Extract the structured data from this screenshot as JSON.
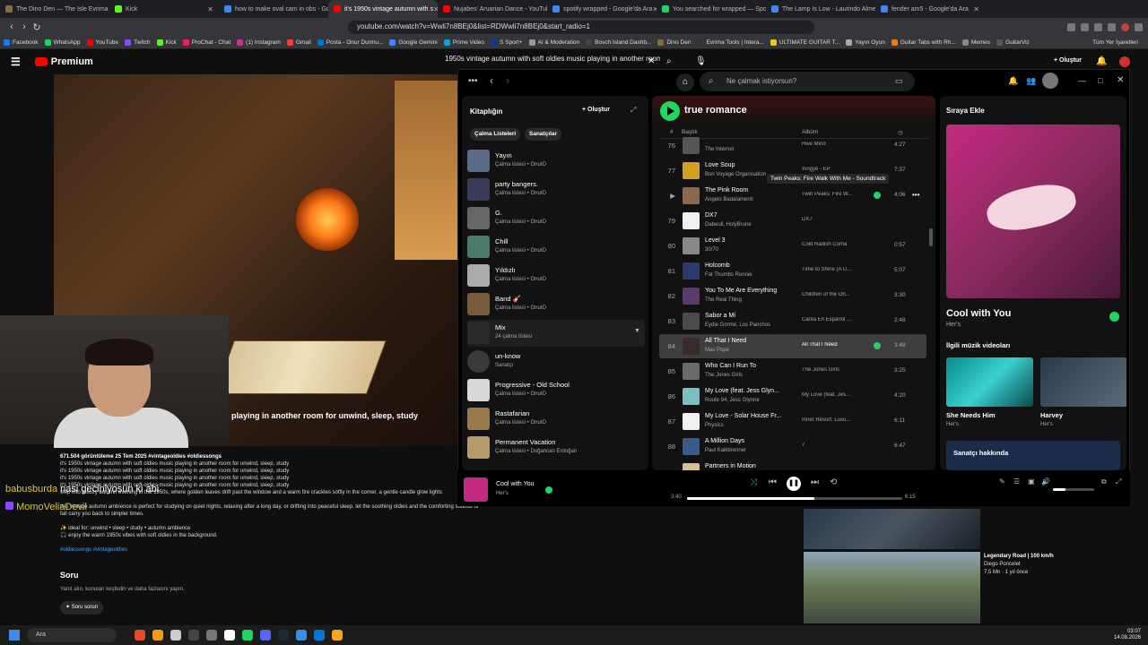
{
  "browser": {
    "tabs": [
      {
        "title": "The Dino Den — The Isle Evrima Co",
        "color": "#8a6a3a"
      },
      {
        "title": "Kick",
        "color": "#53fc18"
      },
      {
        "title": "how to make oval cam in obs - Goog",
        "color": "#4285f4"
      },
      {
        "title": "it's 1950s vintage autumn with s",
        "color": "#ff0000",
        "active": true
      },
      {
        "title": "Nujabes' Aruarian Dance - YouTube",
        "color": "#ff0000"
      },
      {
        "title": "spotify wrapped - Google'da Ara",
        "color": "#4285f4"
      },
      {
        "title": "You searched for wrapped — Spotify",
        "color": "#1ed760"
      },
      {
        "title": "The Lamp Is Low - Laurindo Almeida",
        "color": "#4285f4"
      },
      {
        "title": "fender am5 - Google'da Ara",
        "color": "#4285f4"
      }
    ],
    "url": "youtube.com/watch?v=Wwli7n8BEj0&list=RDWwli7n8BEj0&start_radio=1",
    "bookmarks": [
      "Facebook",
      "WhatsApp",
      "YouTube",
      "Twitch",
      "Kick",
      "ProChat - Chat",
      "(1) Instagram",
      "Gmail",
      "Posta - Onur Durmu...",
      "Google Gemini",
      "Prime Video",
      "S Sport+",
      "AI & Moderation",
      "Bosch Island Dashb...",
      "Dino Den",
      "Evrima Tools | Intera...",
      "ULTIMATE GUITAR T...",
      "Yayın Oyun",
      "Guitar Tabs with Rh...",
      "Memes",
      "GuitarViz"
    ],
    "bookmarks_all": "Tüm Yer İşaretleri"
  },
  "youtube": {
    "logo": "Premium",
    "search_value": "1950s vintage autumn with soft oldies music playing in another room",
    "create_label": "+ Oluştur",
    "video_title_visible": "playing in another room for unwind, sleep, study",
    "views": "671.504 görüntüleme  25 Tem 2025  #vintageoldies #oldiessongs",
    "desc_lines": [
      "it's 1950s vintage autumn with soft oldies music playing in another room for unwind, sleep, study",
      "it's 1950s vintage autumn with soft oldies music playing in another room for unwind, sleep, study",
      "it's 1950s vintage autumn with soft oldies music playing in another room for unwind, sleep, study",
      "it's 1950s vintage autumn with soft oldies music playing in another room for unwind, sleep, study",
      "step into a cozy autumn evening in the 1950s, where golden leaves drift past the window and a warm fire crackles softly in the corner. a gentle candle glow lights",
      "",
      "this vintage autumn ambience is perfect for studying on quiet nights, relaxing after a long day, or drifting into peaceful sleep. let the soothing oldies and the comforting sounds of fall carry you back to simpler times.",
      "",
      "✨ ideal for: unwind • sleep • study • autumn ambience",
      "🎧 enjoy the warm 1950s vibes with soft oldies in the background.",
      "",
      "#oldiessongs #vintageoldies"
    ],
    "soru_title": "Soru",
    "soru_sub": "Yanıt alın, konuları keşfedin ve daha fazlasını yapın.",
    "soru_btn": "✦ Soru sorun",
    "related": {
      "title": "Legendary Road | 100 km/h",
      "channel": "Diego Poncelet",
      "meta": "7,5 Mn · 1 yıl önce"
    }
  },
  "chat": [
    {
      "user": "babusburda",
      "msg": "nasi geciniyosun ki abi"
    },
    {
      "user": "MomoVeliaDevil",
      "msg": ""
    }
  ],
  "spotify": {
    "search_placeholder": "Ne çalmak istiyorsun?",
    "library": {
      "title": "Kitaplığın",
      "create": "+ Oluştur",
      "chips": [
        "Çalma Listeleri",
        "Sanatçılar"
      ],
      "items": [
        {
          "name": "Yayın",
          "sub": "Çalma listesi • OnurD",
          "color": "#5a6b8a"
        },
        {
          "name": "party bangers.",
          "sub": "Çalma listesi • OnurD",
          "color": "#3a3a5a"
        },
        {
          "name": "G.",
          "sub": "Çalma listesi • OnurD",
          "color": "#666"
        },
        {
          "name": "Chill",
          "sub": "Çalma listesi • OnurD",
          "color": "#4a7a6a"
        },
        {
          "name": "Yıldızlı",
          "sub": "Çalma listesi • OnurD",
          "color": "#aaa"
        },
        {
          "name": "Band 🎸",
          "sub": "Çalma listesi • OnurD",
          "color": "#7a5a3a"
        },
        {
          "name": "Mix",
          "sub": "24 çalma listesi",
          "color": "#2a2a2a"
        },
        {
          "name": "un-know",
          "sub": "Sanatçı",
          "color": "#3a3a3a"
        },
        {
          "name": "Progressive - Old School",
          "sub": "Çalma listesi • OnurD",
          "color": "#d8d8d8"
        },
        {
          "name": "Rastafarian",
          "sub": "Çalma listesi • OnurD",
          "color": "#9a7a4a"
        },
        {
          "name": "Permanent Vacation",
          "sub": "Çalma listesi • Doğancan Erdoğan",
          "color": "#b89a6a"
        }
      ]
    },
    "playlist": {
      "title": "true romance",
      "col_num": "#",
      "col_title": "Başlık",
      "col_album": "Albüm",
      "tooltip": "Twin Peaks: Fire Walk With Me - Soundtrack",
      "tracks": [
        {
          "n": "76",
          "title": "",
          "artist": "The Internet",
          "album": "Hive Mind",
          "dur": "4:27",
          "color": "#555"
        },
        {
          "n": "77",
          "title": "Love Soup",
          "artist": "Bon Voyage Organisation",
          "album": "Xingyé - EP",
          "dur": "7:37",
          "color": "#d4a020"
        },
        {
          "n": "▶",
          "title": "The Pink Room",
          "artist": "Angelo Badalamenti",
          "album": "Twin Peaks: Fire W...",
          "dur": "4:06",
          "color": "#8a6a4a",
          "liked": true
        },
        {
          "n": "79",
          "title": "DX7",
          "artist": "Dabeull, HolyBrune",
          "album": "DX7",
          "dur": "",
          "color": "#f0f0f0"
        },
        {
          "n": "80",
          "title": "Level 3",
          "artist": "30/70",
          "album": "Cold Radish Coma",
          "dur": "0:57",
          "color": "#888"
        },
        {
          "n": "81",
          "title": "Holcomb",
          "artist": "Fat Thumbs Ronnie",
          "album": "Time to Shine (A U...",
          "dur": "5:07",
          "color": "#2a3a6a"
        },
        {
          "n": "82",
          "title": "You To Me Are Everything",
          "artist": "The Real Thing",
          "album": "Children of the Gh...",
          "dur": "3:30",
          "color": "#5a3a6a"
        },
        {
          "n": "83",
          "title": "Sabor a Mí",
          "artist": "Eydie Gormé, Los Panchos",
          "album": "Canta En Español ...",
          "dur": "2:48",
          "color": "#4a4a4a"
        },
        {
          "n": "84",
          "title": "All That I Need",
          "artist": "Max Pope",
          "album": "All That I Need",
          "dur": "3:48",
          "color": "#3a2a2a",
          "liked": true,
          "selected": true
        },
        {
          "n": "85",
          "title": "Who Can I Run To",
          "artist": "The Jones Girls",
          "album": "The Jones Girls",
          "dur": "3:25",
          "color": "#6a6a6a"
        },
        {
          "n": "86",
          "title": "My Love (feat. Jess Glyn...",
          "artist": "Route 94, Jess Glynne",
          "album": "My Love (feat. Jes...",
          "dur": "4:20",
          "color": "#7ac0c0"
        },
        {
          "n": "87",
          "title": "My Love - Solar House Fr...",
          "artist": "Physics",
          "album": "Inner Resort: Luxu...",
          "dur": "6:11",
          "color": "#f0f0f0"
        },
        {
          "n": "88",
          "title": "A Million Days",
          "artist": "Paul Kalkbrenner",
          "album": "7",
          "dur": "6:47",
          "color": "#3a5a8a"
        },
        {
          "n": "",
          "title": "Partners in Motion",
          "artist": "",
          "album": "",
          "dur": "",
          "color": "#d8c090"
        }
      ]
    },
    "queue": {
      "title": "Sıraya Ekle",
      "now_title": "Cool with You",
      "now_artist": "Her's",
      "related_title": "İlgili müzik videoları",
      "videos": [
        {
          "title": "She Needs Him",
          "artist": "Her's"
        },
        {
          "title": "Harvey",
          "artist": "Her's"
        }
      ],
      "about": "Sanatçı hakkında"
    },
    "player": {
      "title": "Cool with You",
      "artist": "Her's",
      "elapsed": "3:40",
      "total": "6:15",
      "progress": 0.59
    }
  },
  "taskbar": {
    "search": "Ara",
    "time": "03:07",
    "date": "14.08.2026"
  },
  "colors": {
    "spotify_green": "#1ed760",
    "youtube_red": "#ff0000"
  }
}
